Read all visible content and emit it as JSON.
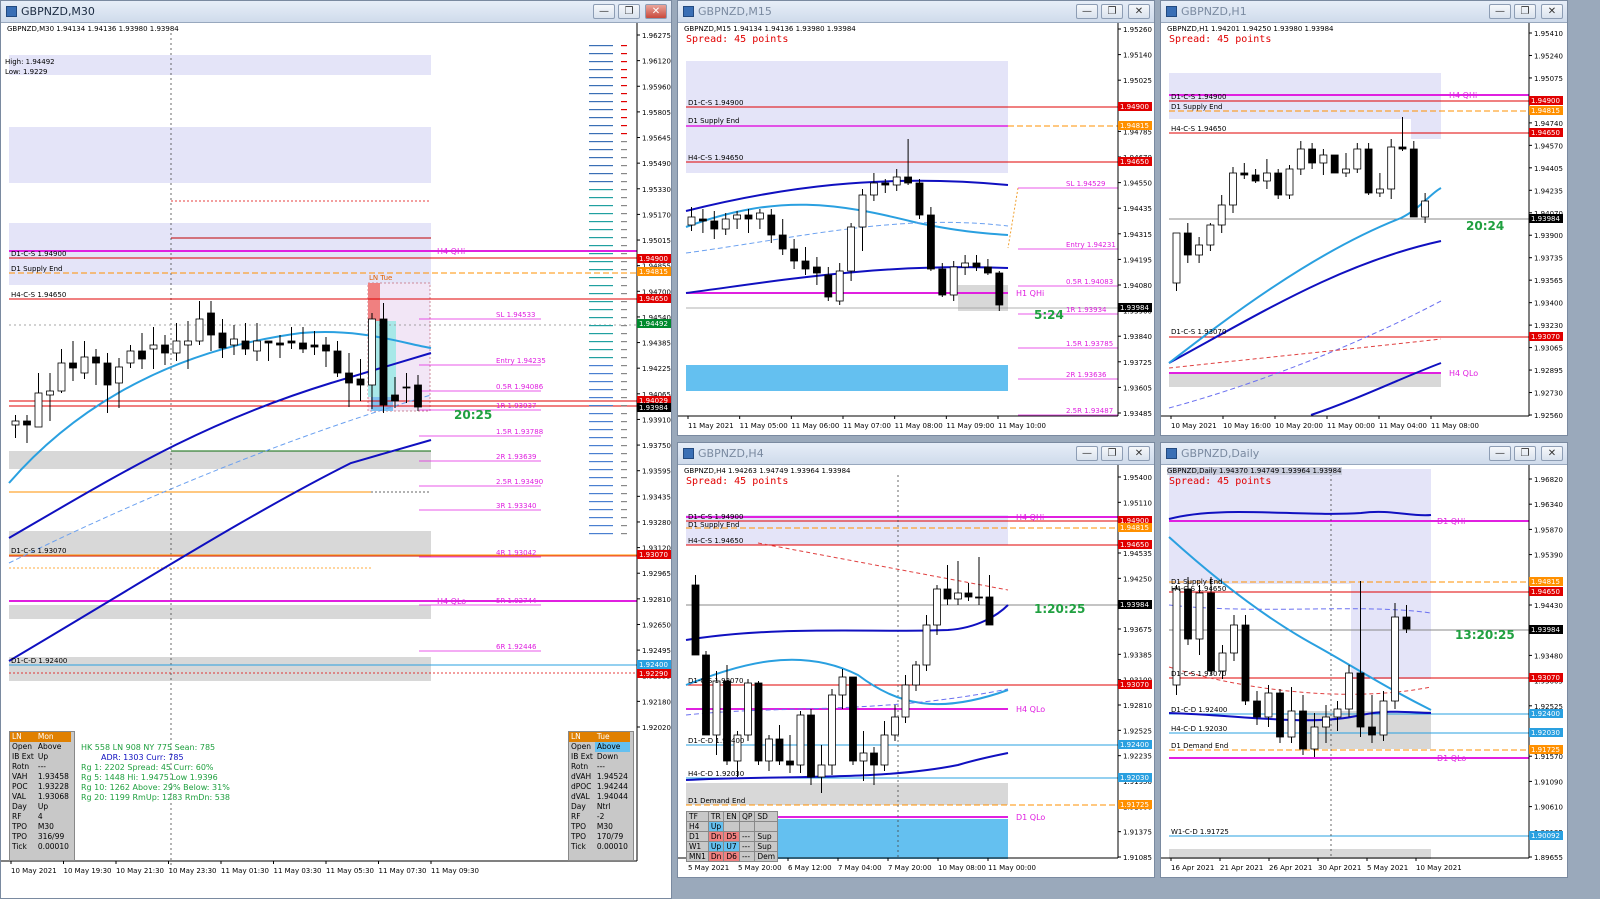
{
  "windows": {
    "m30": {
      "title": "GBPNZD,M30",
      "header": "GBPNZD,M30  1.94134 1.94136 1.93980 1.93984",
      "high_label": "High: 1.94492",
      "low_label": "Low: 1.9229",
      "countdown": "20:25",
      "ln_tue_label": "LN Tue",
      "price_axis": [
        "1.96275",
        "1.96120",
        "1.95960",
        "1.95805",
        "1.95645",
        "1.95490",
        "1.95330",
        "1.95170",
        "1.95015",
        "1.94855",
        "1.94700",
        "1.94540",
        "1.94385",
        "1.94225",
        "1.94065",
        "1.93910",
        "1.93750",
        "1.93595",
        "1.93435",
        "1.93280",
        "1.93120",
        "1.92965",
        "1.92810",
        "1.92650",
        "1.92495",
        "1.92335",
        "1.92180",
        "1.92020"
      ],
      "price_tags": [
        {
          "text": "1.94900",
          "color": "#e00000"
        },
        {
          "text": "1.94815",
          "color": "#ff9000"
        },
        {
          "text": "1.94650",
          "color": "#e00000"
        },
        {
          "text": "1.94492",
          "color": "#008a2e"
        },
        {
          "text": "1.94029",
          "color": "#e00000"
        },
        {
          "text": "1.93984",
          "color": "#000000"
        },
        {
          "text": "1.93070",
          "color": "#e00000"
        },
        {
          "text": "1.92400",
          "color": "#2aa0e0"
        },
        {
          "text": "1.92290",
          "color": "#e00000"
        }
      ],
      "levels": [
        {
          "text": "D1-C-S 1.94900"
        },
        {
          "text": "D1 Supply End"
        },
        {
          "text": "H4-C-S 1.94650"
        },
        {
          "text": "D1-C-S 1.93070"
        },
        {
          "text": "D1-C-D 1.92400"
        },
        {
          "text": "H4 QHi"
        },
        {
          "text": "H4 QLo"
        }
      ],
      "fib_levels": [
        "SL 1.94533",
        "Entry 1.94235",
        "0.5R 1.94086",
        "1R 1.93937",
        "1.5R 1.93788",
        "2R 1.93639",
        "2.5R 1.93490",
        "3R 1.93340",
        "4R 1.93042",
        "5R 1.92744",
        "6R 1.92446"
      ],
      "time_axis": [
        "10 May 2021",
        "10 May 19:30",
        "10 May 21:30",
        "10 May 23:30",
        "11 May 01:30",
        "11 May 03:30",
        "11 May 05:30",
        "11 May 07:30",
        "11 May 09:30"
      ],
      "left_panel": {
        "head": [
          "LN",
          "Mon"
        ],
        "rows": [
          [
            "Open",
            "Above"
          ],
          [
            "IB Ext",
            "Up"
          ],
          [
            "Rotn",
            "---"
          ],
          [
            "VAH",
            "1.93458"
          ],
          [
            "POC",
            "1.93228"
          ],
          [
            "VAL",
            "1.93068"
          ],
          [
            "Day",
            "Up"
          ],
          [
            "RF",
            "4"
          ],
          [
            "TPO",
            "M30"
          ],
          [
            "TPO",
            "316/99"
          ],
          [
            "Tick",
            "0.00010"
          ]
        ]
      },
      "right_panel": {
        "head": [
          "LN",
          "Tue"
        ],
        "rows": [
          [
            "Open",
            "Above"
          ],
          [
            "IB Ext",
            "Down"
          ],
          [
            "Rotn",
            "---"
          ],
          [
            "dVAH",
            "1.94524"
          ],
          [
            "dPOC",
            "1.94244"
          ],
          [
            "dVAL",
            "1.94044"
          ],
          [
            "Day",
            "Ntrl"
          ],
          [
            "RF",
            "-2"
          ],
          [
            "TPO",
            "M30"
          ],
          [
            "TPO",
            "170/79"
          ],
          [
            "Tick",
            "0.00010"
          ]
        ]
      },
      "stats": {
        "line1": "HK 558  LN 908  NY 775  Sean: 785",
        "line2": "ADR:  1303   Curr:   785",
        "line3": "Rg 1:  2202  Spread:  45    Curr:   60%",
        "line4": "Rg 5:  1448  Hi: 1.9475  Low  1.9396",
        "line5": "Rg 10:  1262  Above: 29%   Below:  31%",
        "line6": "Rg 20:  1199  RmUp:  1283   RmDn:  538"
      }
    },
    "m15": {
      "title": "GBPNZD,M15",
      "header": "GBPNZD,M15  1.94134 1.94136 1.93980 1.93984",
      "spread": "Spread: 45 points",
      "countdown": "5:24",
      "price_axis": [
        "1.95260",
        "1.95140",
        "1.95025",
        "1.94905",
        "1.94785",
        "1.94670",
        "1.94550",
        "1.94435",
        "1.94315",
        "1.94195",
        "1.94080",
        "1.93960",
        "1.93840",
        "1.93725",
        "1.93605",
        "1.93485"
      ],
      "price_tags": [
        {
          "text": "1.94900",
          "color": "#e00000"
        },
        {
          "text": "1.94815",
          "color": "#ff9000"
        },
        {
          "text": "1.94650",
          "color": "#e00000"
        },
        {
          "text": "1.93984",
          "color": "#000000"
        }
      ],
      "levels": [
        "D1-C-S 1.94900",
        "D1 Supply End",
        "H4-C-S 1.94650",
        "H1 QHi"
      ],
      "fib_levels": [
        "SL 1.94529",
        "Entry 1.94231",
        "0.5R 1.94083",
        "1R 1.93934",
        "1.5R 1.93785",
        "2R 1.93636",
        "2.5R 1.93487"
      ],
      "time_axis": [
        "11 May 2021",
        "11 May 05:00",
        "11 May 06:00",
        "11 May 07:00",
        "11 May 08:00",
        "11 May 09:00",
        "11 May 10:00"
      ]
    },
    "h1": {
      "title": "GBPNZD,H1",
      "header": "GBPNZD,H1  1.94201 1.94250 1.93980 1.93984",
      "spread": "Spread: 45 points",
      "countdown": "20:24",
      "price_axis": [
        "1.95410",
        "1.95240",
        "1.95075",
        "1.94905",
        "1.94740",
        "1.94570",
        "1.94405",
        "1.94235",
        "1.94070",
        "1.93900",
        "1.93735",
        "1.93565",
        "1.93400",
        "1.93230",
        "1.93065",
        "1.92895",
        "1.92730",
        "1.92560"
      ],
      "price_tags": [
        {
          "text": "1.94900",
          "color": "#e00000"
        },
        {
          "text": "1.94815",
          "color": "#ff9000"
        },
        {
          "text": "1.94650",
          "color": "#e00000"
        },
        {
          "text": "1.93984",
          "color": "#000000"
        },
        {
          "text": "1.93070",
          "color": "#e00000"
        }
      ],
      "levels": [
        "D1-C-S 1.94900",
        "D1 Supply End",
        "H4-C-S 1.94650",
        "D1-C-S 1.93070",
        "H4 QHi",
        "H4 QLo"
      ],
      "time_axis": [
        "10 May 2021",
        "10 May 16:00",
        "10 May 20:00",
        "11 May 00:00",
        "11 May 04:00",
        "11 May 08:00"
      ]
    },
    "h4": {
      "title": "GBPNZD,H4",
      "header": "GBPNZD,H4  1.94263 1.94749 1.93964 1.93984",
      "spread": "Spread: 45 points",
      "countdown": "1:20:25",
      "price_axis": [
        "1.95400",
        "1.95110",
        "1.94825",
        "1.94535",
        "1.94250",
        "1.93960",
        "1.93675",
        "1.93385",
        "1.93100",
        "1.92810",
        "1.92525",
        "1.92235",
        "1.91950",
        "1.91660",
        "1.91375",
        "1.91085"
      ],
      "price_tags": [
        {
          "text": "1.94900",
          "color": "#e00000"
        },
        {
          "text": "1.94815",
          "color": "#ff9000"
        },
        {
          "text": "1.94650",
          "color": "#e00000"
        },
        {
          "text": "1.93984",
          "color": "#000000"
        },
        {
          "text": "1.93070",
          "color": "#e00000"
        },
        {
          "text": "1.92400",
          "color": "#2aa0e0"
        },
        {
          "text": "1.92030",
          "color": "#2aa0e0"
        },
        {
          "text": "1.91725",
          "color": "#ff9000"
        }
      ],
      "levels": [
        "D1-C-S 1.94900",
        "D1 Supply End",
        "H4-C-S 1.94650",
        "D1-C-S 1.93070",
        "D1-C-D 1.92400",
        "H4-C-D 1.92030",
        "D1 Demand End",
        "H4 QHi",
        "H4 QLo",
        "D1 QLo"
      ],
      "time_axis": [
        "5 May 2021",
        "5 May 20:00",
        "6 May 12:00",
        "7 May 04:00",
        "7 May 20:00",
        "10 May 08:00",
        "11 May 00:00"
      ],
      "trend_table": {
        "head": [
          "TF",
          "TR",
          "EN",
          "QP",
          "SD"
        ],
        "rows": [
          [
            "H4",
            "Up",
            "",
            "",
            ""
          ],
          [
            "D1",
            "Dn",
            "D5",
            "---",
            "Sup"
          ],
          [
            "W1",
            "Up",
            "U7",
            "---",
            "Sup"
          ],
          [
            "MN1",
            "Dn",
            "D6",
            "---",
            "Dem"
          ]
        ]
      }
    },
    "daily": {
      "title": "GBPNZD,Daily",
      "header": "GBPNZD,Daily  1.94370 1.94749 1.93964 1.93984",
      "spread": "Spread: 45 points",
      "countdown": "13:20:25",
      "price_axis": [
        "1.96820",
        "1.96340",
        "1.95870",
        "1.95390",
        "1.94915",
        "1.94430",
        "1.93960",
        "1.93480",
        "1.93005",
        "1.92525",
        "1.92045",
        "1.91570",
        "1.91090",
        "1.90610",
        "1.90135",
        "1.89655"
      ],
      "price_tags": [
        {
          "text": "1.94815",
          "color": "#ff9000"
        },
        {
          "text": "1.94650",
          "color": "#e00000"
        },
        {
          "text": "1.93984",
          "color": "#000000"
        },
        {
          "text": "1.93070",
          "color": "#e00000"
        },
        {
          "text": "1.92400",
          "color": "#2aa0e0"
        },
        {
          "text": "1.92030",
          "color": "#2aa0e0"
        },
        {
          "text": "1.91725",
          "color": "#ff9000"
        },
        {
          "text": "1.90092",
          "color": "#2aa0e0"
        }
      ],
      "levels": [
        "D1 Supply End",
        "H4-C-S 1.94650",
        "D1-C-S 1.93070",
        "D1-C-D 1.92400",
        "H4-C-D 1.92030",
        "D1 Demand End",
        "W1-C-D 1.91725",
        "D1 QHi",
        "D1 QLo"
      ],
      "time_axis": [
        "16 Apr 2021",
        "21 Apr 2021",
        "26 Apr 2021",
        "30 Apr 2021",
        "5 May 2021",
        "10 May 2021"
      ]
    }
  },
  "colors": {
    "supply_zone": "#e4e4f8",
    "demand_zone": "#d8d8d8",
    "resistance": "#e00000",
    "magenta_level": "#e020e0",
    "ma_dark": "#1010c0",
    "ma_light": "#2aa0e0",
    "countdown": "#20a040"
  }
}
